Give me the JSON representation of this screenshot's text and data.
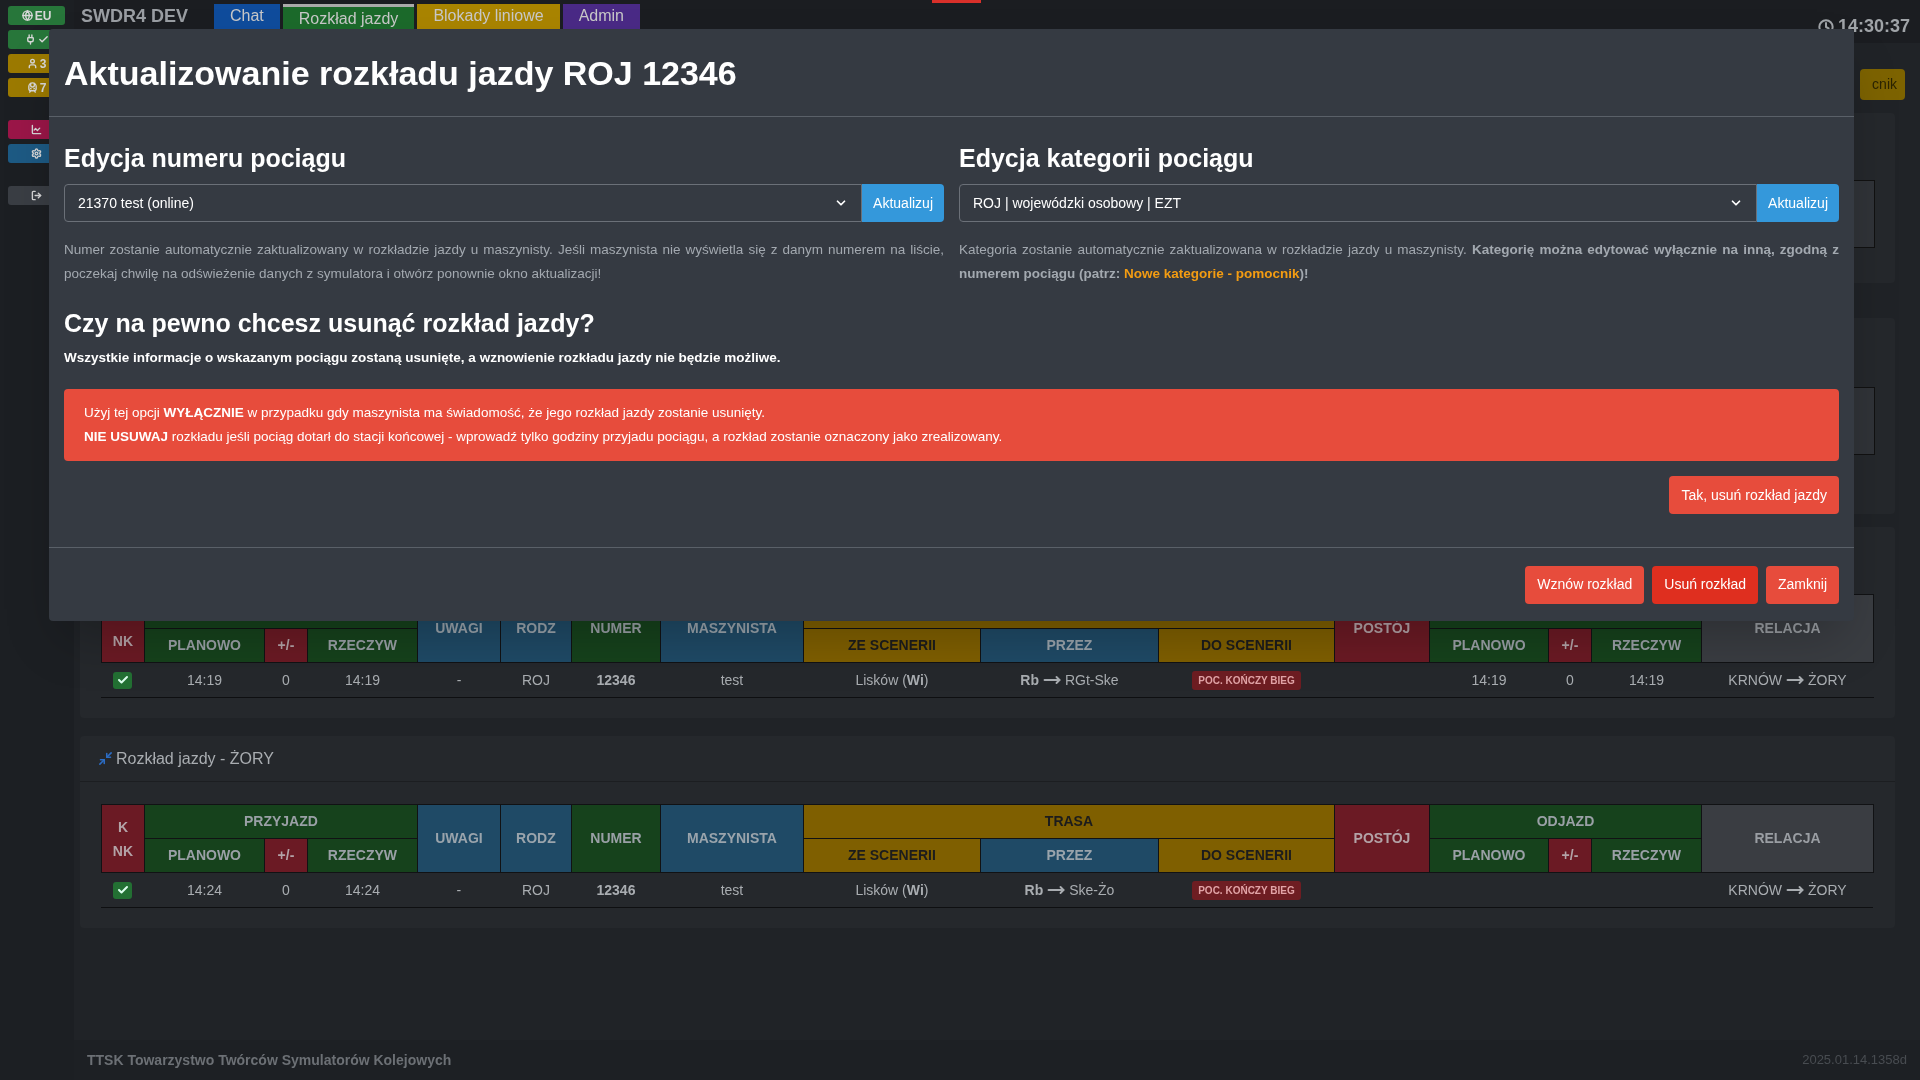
{
  "sidebar": {
    "groups": [
      [
        {
          "kind": "globe",
          "label": "EU",
          "color": "#27763a"
        },
        {
          "kind": "plug-check",
          "color": "#27763a"
        },
        {
          "kind": "user",
          "label": "3",
          "color": "#9c7a00"
        },
        {
          "kind": "train",
          "label": "7",
          "color": "#9c7a00"
        }
      ],
      [
        {
          "kind": "chart",
          "color": "#9b1648"
        },
        {
          "kind": "settings",
          "color": "#1d5a84"
        }
      ],
      [
        {
          "kind": "logout",
          "color": "#3a3e44"
        }
      ]
    ]
  },
  "topbar": {
    "brand": "SWDR4 DEV",
    "tabs": [
      {
        "label": "Chat",
        "color": "#0f4c9c",
        "selected": false
      },
      {
        "label": "Rozkład jazdy",
        "color": "#1c6a2b",
        "selected": true
      },
      {
        "label": "Blokady liniowe",
        "color": "#a98400",
        "selected": false
      },
      {
        "label": "Admin",
        "color": "#4a2a86",
        "selected": false
      }
    ],
    "clock": "14:30:37"
  },
  "toolbar": {
    "button": "cnik"
  },
  "tables": [
    {
      "header": {
        "k_nk": [
          "NK"
        ],
        "uwagi": "UWAGI",
        "rodz": "RODZ",
        "numer": "NUMER",
        "maszynista": "MASZYNISTA",
        "postoj": "POSTÓJ",
        "relacja": "RELACJA",
        "sub": [
          "PLANOWO",
          "+/-",
          "RZECZYW",
          "ZE SCENERII",
          "PRZEZ",
          "DO SCENERII",
          "PLANOWO",
          "+/-",
          "RZECZYW"
        ]
      },
      "rows": [
        {
          "checked": true,
          "arr_plan": "14:19",
          "arr_diff": "0",
          "arr_real": "14:19",
          "remarks": "-",
          "category": "ROJ",
          "number": "12346",
          "driver": "test",
          "from": "Lisków (**Wi**)",
          "via_from": "Rb",
          "via_to": "RGt-Ske",
          "to_badge": "POC. KOŃCZY BIEG",
          "dep_plan": "14:19",
          "dep_diff": "0",
          "dep_real": "14:19",
          "rel_from": "KRNÓW",
          "rel_to": "ŻORY"
        }
      ]
    },
    {
      "title": "Rozkład jazdy - ŻORY",
      "header": {
        "k_nk": [
          "K",
          "NK"
        ],
        "arrival": "PRZYJAZD",
        "route": "TRASA",
        "departure": "ODJAZD",
        "uwagi": "UWAGI",
        "rodz": "RODZ",
        "numer": "NUMER",
        "maszynista": "MASZYNISTA",
        "postoj": "POSTÓJ",
        "relacja": "RELACJA",
        "sub": [
          "PLANOWO",
          "+/-",
          "RZECZYW",
          "ZE SCENERII",
          "PRZEZ",
          "DO SCENERII",
          "PLANOWO",
          "+/-",
          "RZECZYW"
        ]
      },
      "rows": [
        {
          "checked": true,
          "arr_plan": "14:24",
          "arr_diff": "0",
          "arr_real": "14:24",
          "remarks": "-",
          "category": "ROJ",
          "number": "12346",
          "driver": "test",
          "from": "Lisków (**Wi**)",
          "via_from": "Rb",
          "via_to": "Ske-Żo",
          "to_badge": "POC. KOŃCZY BIEG",
          "rel_from": "KRNÓW",
          "rel_to": "ŻORY"
        }
      ]
    }
  ],
  "footer": {
    "left": "TTSK Towarzystwo Twórców Symulatorów Kolejowych",
    "right": "2025.01.14.1358d"
  },
  "modal": {
    "title": "Aktualizowanie rozkładu jazdy ROJ 12346",
    "sections": [
      {
        "heading": "Edycja numeru pociągu",
        "select": "21370 test (online)",
        "button": "Aktualizuj",
        "help": "Numer zostanie automatycznie zaktualizowany w rozkładzie jazdy u maszynisty. Jeśli maszynista nie wyświetla się z danym numerem na liście, poczekaj chwilę na odświeżenie danych z symulatora i otwórz ponownie okno aktualizacji!"
      },
      {
        "heading": "Edycja kategorii pociągu",
        "select": "ROJ | wojewódzki osobowy | EZT",
        "button": "Aktualizuj",
        "help": "Kategoria zostanie automatycznie zaktualizowana w rozkładzie jazdy u maszynisty. **Kategorię można edytować wyłącznie na inną, zgodną z numerem pociągu (patrz:**",
        "link": "Nowe kategorie - pomocnik",
        "help_after": "**)!**"
      }
    ],
    "delete": {
      "heading": "Czy na pewno chcesz usunąć rozkład jazdy?",
      "text": "Wszystkie informacje o wskazanym pociągu zostaną usunięte, a wznowienie rozkładu jazdy nie będzie możliwe.",
      "alert": [
        "Użyj tej opcji **WYŁĄCZNIE** w przypadku gdy maszynista ma świadomość, że jego rozkład jazdy zostanie usunięty.",
        "**NIE USUWAJ** rozkładu jeśli pociąg dotarł do stacji końcowej - wprowadź tylko godziny przyjadu pociągu, a rozkład zostanie oznaczony jako zrealizowany."
      ],
      "confirm": "Tak, usuń rozkład jazdy"
    },
    "footer_buttons": [
      {
        "label": "Wznów rozkład",
        "kind": "light"
      },
      {
        "label": "Usuń rozkład",
        "kind": "dark"
      },
      {
        "label": "Zamknij",
        "kind": "light"
      }
    ]
  }
}
